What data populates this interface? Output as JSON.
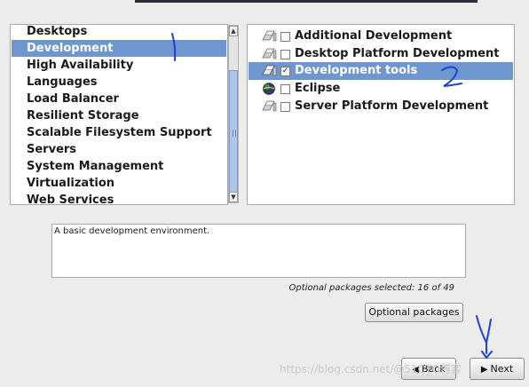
{
  "groups": {
    "items": [
      {
        "label": "Desktops",
        "selected": false
      },
      {
        "label": "Development",
        "selected": true
      },
      {
        "label": "High Availability",
        "selected": false
      },
      {
        "label": "Languages",
        "selected": false
      },
      {
        "label": "Load Balancer",
        "selected": false
      },
      {
        "label": "Resilient Storage",
        "selected": false
      },
      {
        "label": "Scalable Filesystem Support",
        "selected": false
      },
      {
        "label": "Servers",
        "selected": false
      },
      {
        "label": "System Management",
        "selected": false
      },
      {
        "label": "Virtualization",
        "selected": false
      },
      {
        "label": "Web Services",
        "selected": false
      }
    ]
  },
  "packages": {
    "items": [
      {
        "label": "Additional Development",
        "checked": false,
        "selected": false,
        "icon": "package-icon",
        "check_mark": ""
      },
      {
        "label": "Desktop Platform Development",
        "checked": false,
        "selected": false,
        "icon": "package-icon",
        "check_mark": ""
      },
      {
        "label": "Development tools",
        "checked": true,
        "selected": true,
        "icon": "package-icon",
        "check_mark": "✓"
      },
      {
        "label": "Eclipse",
        "checked": false,
        "selected": false,
        "icon": "eclipse-icon",
        "check_mark": ""
      },
      {
        "label": "Server Platform Development",
        "checked": false,
        "selected": false,
        "icon": "package-icon",
        "check_mark": ""
      }
    ]
  },
  "description": {
    "text": "A basic development environment."
  },
  "optional": {
    "count_text": "Optional packages selected: 16 of 49",
    "button_label": "Optional packages"
  },
  "nav": {
    "back_label": "Back",
    "next_label": "Next"
  },
  "watermark": {
    "text": "https://blog.csdn.net/@51CTO博客"
  },
  "colors": {
    "selection": "#6f97cf",
    "annotation_ink": "#1f3fd6"
  }
}
